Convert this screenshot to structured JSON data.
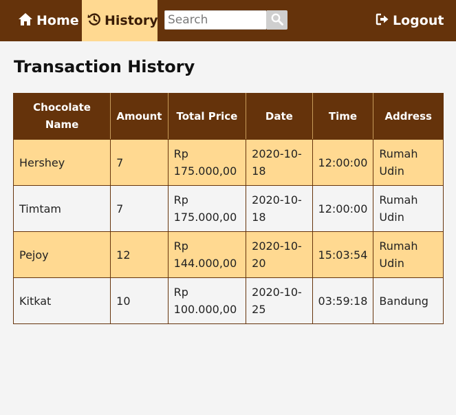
{
  "nav": {
    "home_label": "Home",
    "history_label": "History",
    "logout_label": "Logout",
    "search_placeholder": "Search"
  },
  "page": {
    "title": "Transaction History"
  },
  "table": {
    "headers": [
      "Chocolate Name",
      "Amount",
      "Total Price",
      "Date",
      "Time",
      "Address"
    ],
    "rows": [
      {
        "name": "Hershey",
        "amount": "7",
        "price": "Rp 175.000,00",
        "date": "2020-10-18",
        "time": "12:00:00",
        "address": "Rumah Udin"
      },
      {
        "name": "Timtam",
        "amount": "7",
        "price": "Rp 175.000,00",
        "date": "2020-10-18",
        "time": "12:00:00",
        "address": "Rumah Udin"
      },
      {
        "name": "Pejoy",
        "amount": "12",
        "price": "Rp 144.000,00",
        "date": "2020-10-20",
        "time": "15:03:54",
        "address": "Rumah Udin"
      },
      {
        "name": "Kitkat",
        "amount": "10",
        "price": "Rp 100.000,00",
        "date": "2020-10-25",
        "time": "03:59:18",
        "address": "Bandung"
      }
    ]
  },
  "colors": {
    "navbar": "#65330b",
    "accent": "#ffd991",
    "background": "#f4f4f4"
  },
  "icons": {
    "home": "home-icon",
    "history": "history-icon",
    "search": "search-icon",
    "logout": "logout-icon"
  }
}
